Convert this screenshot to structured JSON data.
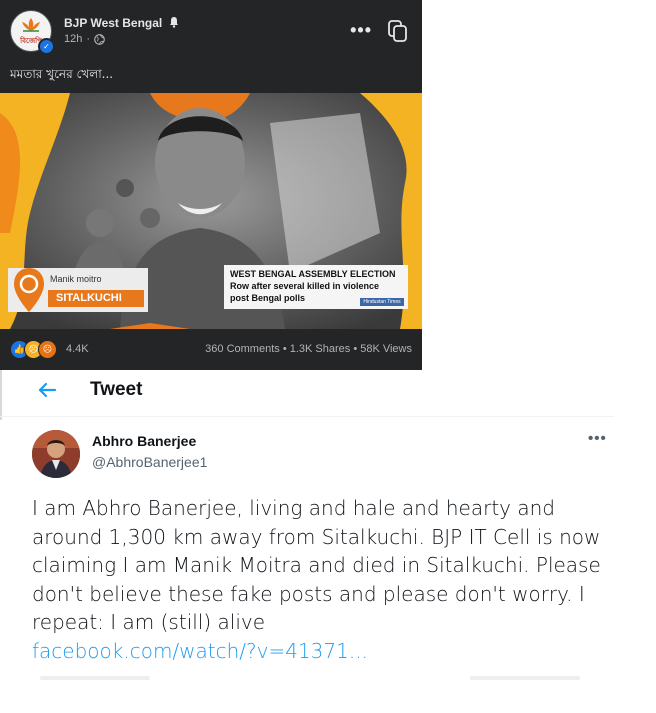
{
  "facebook": {
    "page_name": "BJP West Bengal",
    "logo_text": "বিজেপি",
    "time": "12h",
    "caption": "মমতার খুনের খেলা...",
    "video": {
      "name_tag": "Manik moitro",
      "place_tag": "SITALKUCHI",
      "headline_lines": [
        "WEST BENGAL ASSEMBLY ELECTION",
        "Row after several killed in violence",
        "post Bengal polls"
      ],
      "channel_logo": "Hindustan Times"
    },
    "reactions_count": "4.4K",
    "stats": "360 Comments • 1.3K Shares • 58K Views",
    "colors": {
      "bg": "#242526",
      "text": "#e4e6eb",
      "muted": "#b0b3b8",
      "like": "#1b74e4",
      "accent": "#e8781c"
    }
  },
  "twitter": {
    "header_title": "Tweet",
    "author_name": "Abhro Banerjee",
    "author_handle": "@AbhroBanerjee1",
    "body": "I am Abhro Banerjee, living and hale and hearty and around 1,300 km away from Sitalkuchi. BJP IT Cell is now claiming I am Manik Moitra and died in Sitalkuchi. Please don't believe these fake posts and please don't worry. I repeat: I am (still) alive",
    "link": "facebook.com/watch/?v=41371...",
    "colors": {
      "link": "#1d9bf0",
      "text": "#0f1419",
      "muted": "#536471"
    }
  }
}
